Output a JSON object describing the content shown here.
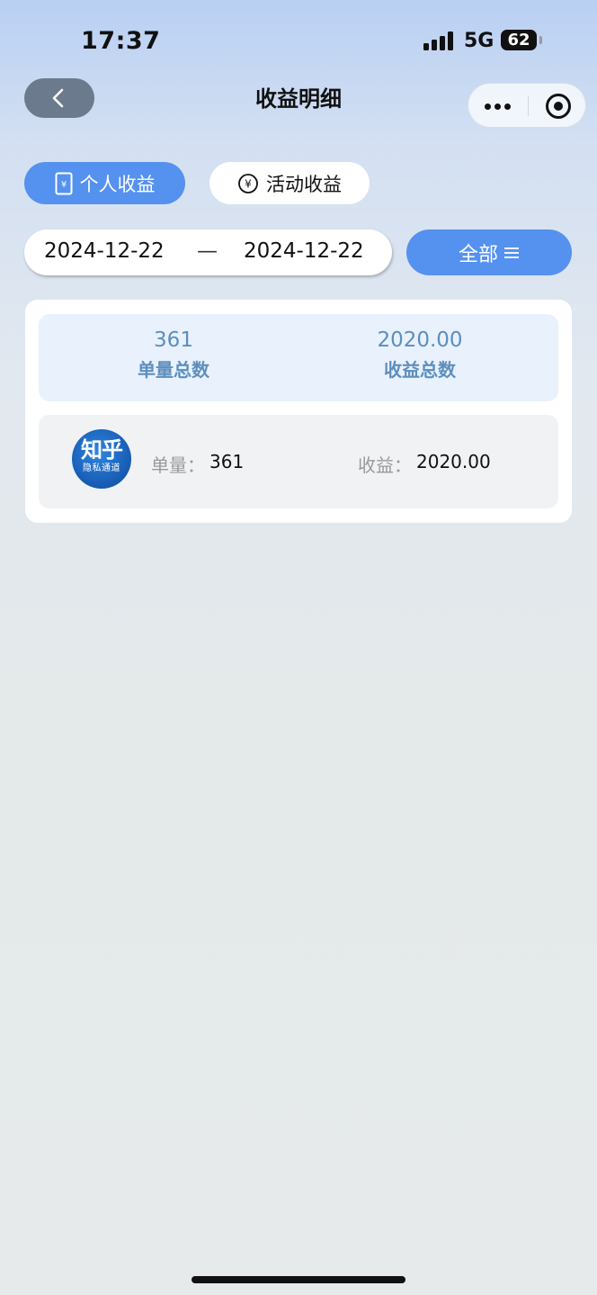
{
  "status_bar": {
    "time": "17:37",
    "network": "5G",
    "battery": "62"
  },
  "header": {
    "title": "收益明细",
    "back_icon": "chevron-left-icon",
    "more_icon": "more-dots-icon",
    "close_icon": "target-circle-icon"
  },
  "tabs": [
    {
      "label": "个人收益",
      "icon": "yuan-receipt-icon",
      "active": true
    },
    {
      "label": "活动收益",
      "icon": "yuan-circle-icon",
      "active": false
    }
  ],
  "filter": {
    "start_date": "2024-12-22",
    "separator": "—",
    "end_date": "2024-12-22",
    "category_label": "全部",
    "category_icon": "menu-lines-icon"
  },
  "summary": {
    "orders_value": "361",
    "orders_label": "单量总数",
    "earnings_value": "2020.00",
    "earnings_label": "收益总数"
  },
  "records": [
    {
      "logo_text": "知乎",
      "logo_subtext": "隐私通道",
      "orders_label": "单量：",
      "orders_value": "361",
      "earnings_label": "收益：",
      "earnings_value": "2020.00"
    }
  ],
  "colors": {
    "accent": "#5591ef",
    "stat_text": "#5c8fbd",
    "summary_bg": "#e9f1fd",
    "back_button": "#6b7b8d"
  }
}
